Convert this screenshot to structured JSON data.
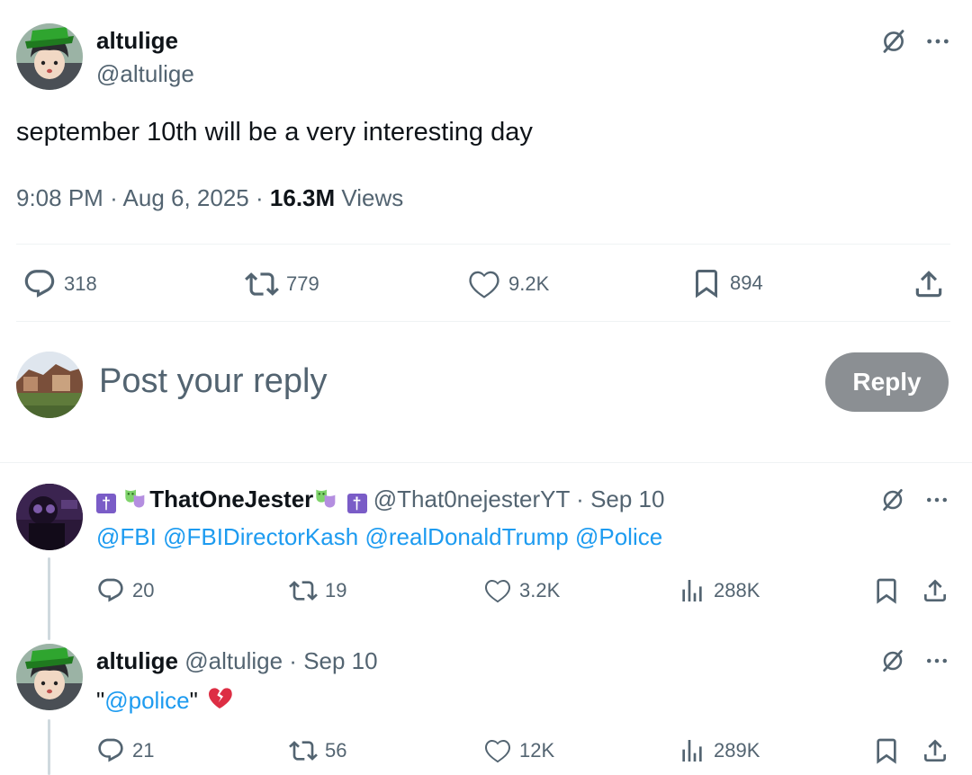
{
  "main_post": {
    "display_name": "altulige",
    "handle": "@altulige",
    "text": "september 10th will be a very interesting day",
    "time": "9:08 PM",
    "date": "Aug 6, 2025",
    "views_count": "16.3M",
    "views_label": "Views",
    "replies": "318",
    "reposts": "779",
    "likes": "9.2K",
    "bookmarks": "894"
  },
  "composer": {
    "placeholder": "Post your reply",
    "button_label": "Reply"
  },
  "replies": [
    {
      "display_name": "ThatOneJester",
      "handle": "@That0nejesterYT",
      "date": "Sep 10",
      "mentions": [
        "@FBI",
        "@FBIDirectorKash",
        "@realDonaldTrump",
        "@Police"
      ],
      "replies": "20",
      "reposts": "19",
      "likes": "3.2K",
      "views": "288K"
    },
    {
      "display_name": "altulige",
      "handle": "@altulige",
      "date": "Sep 10",
      "text_open_quote": "\"",
      "mention": "@police",
      "text_close_quote": "\"",
      "replies": "21",
      "reposts": "56",
      "likes": "12K",
      "views": "289K"
    }
  ],
  "colors": {
    "link": "#1d9bf0",
    "secondary_text": "#536471",
    "reply_button": "#8b8f93",
    "divider": "#eff3f4"
  },
  "icons": [
    "grok-icon",
    "more-icon",
    "reply-icon",
    "repost-icon",
    "like-icon",
    "bookmark-icon",
    "share-icon",
    "views-icon",
    "cross-badge-icon",
    "mask-emoji-icon",
    "broken-heart-icon"
  ]
}
